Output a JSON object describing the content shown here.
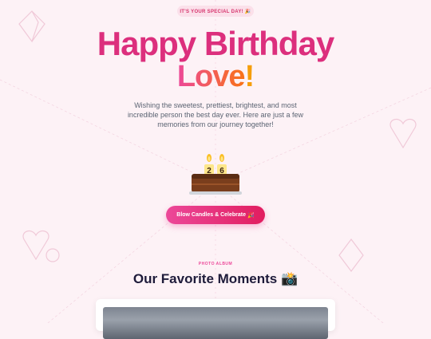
{
  "badge": {
    "text": "IT'S YOUR SPECIAL DAY! 🎉"
  },
  "hero": {
    "title_line1": "Happy Birthday",
    "title_line2_word": "Love",
    "title_line2_punct": "!",
    "subtitle": "Wishing the sweetest, prettiest, brightest, and most incredible person the best day ever. Here are just a few memories from our journey together!"
  },
  "cake": {
    "candle_digits": [
      "2",
      "6"
    ]
  },
  "cta": {
    "label": "Blow Candles & Celebrate",
    "emoji": "🎉"
  },
  "album": {
    "kicker": "PHOTO ALBUM",
    "title": "Our Favorite Moments 📸"
  },
  "colors": {
    "accent": "#ec4899",
    "title_pink": "#dc2f7d",
    "orange": "#f97316",
    "ink": "#1e1b3a"
  }
}
